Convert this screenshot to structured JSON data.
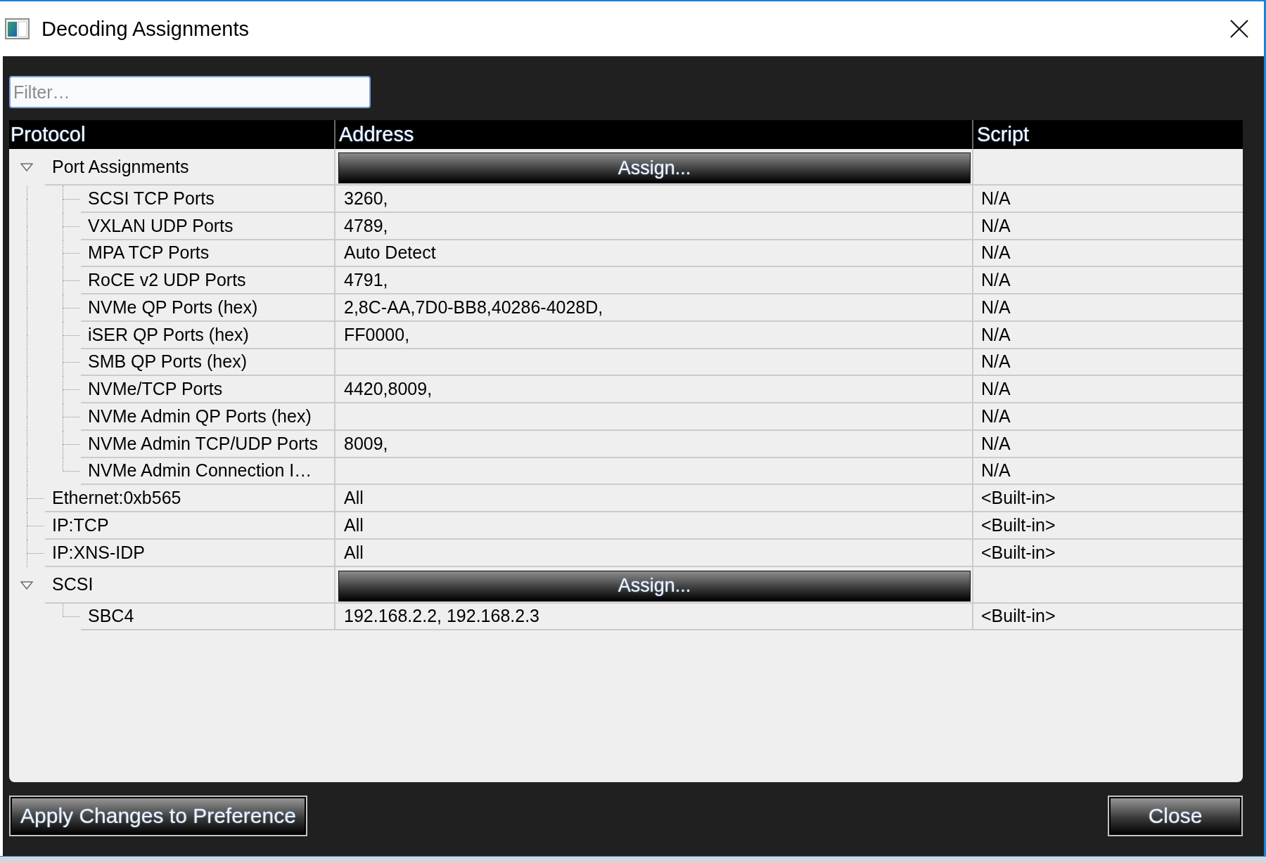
{
  "window": {
    "title": "Decoding Assignments"
  },
  "filter": {
    "placeholder": "Filter…"
  },
  "table": {
    "columns": [
      "Protocol",
      "Address",
      "Script"
    ],
    "rows": [
      {
        "kind": "group",
        "protocol": "Port Assignments",
        "expanded": true,
        "button": "Assign...",
        "children": [
          {
            "kind": "entry",
            "protocol": "SCSI TCP Ports",
            "address": "3260,",
            "script": "N/A"
          },
          {
            "kind": "entry",
            "protocol": "VXLAN UDP Ports",
            "address": "4789,",
            "script": "N/A"
          },
          {
            "kind": "entry",
            "protocol": "MPA TCP Ports",
            "address": "Auto Detect",
            "script": "N/A"
          },
          {
            "kind": "entry",
            "protocol": "RoCE v2 UDP Ports",
            "address": "4791,",
            "script": "N/A"
          },
          {
            "kind": "entry",
            "protocol": "NVMe QP Ports (hex)",
            "address": "2,8C-AA,7D0-BB8,40286-4028D,",
            "script": "N/A"
          },
          {
            "kind": "entry",
            "protocol": "iSER QP Ports (hex)",
            "address": "FF0000,",
            "script": "N/A"
          },
          {
            "kind": "entry",
            "protocol": "SMB QP Ports (hex)",
            "script": "N/A"
          },
          {
            "kind": "entry",
            "protocol": "NVMe/TCP Ports",
            "address": "4420,8009,",
            "script": "N/A"
          },
          {
            "kind": "entry",
            "protocol": "NVMe Admin QP Ports (hex)",
            "script": "N/A"
          },
          {
            "kind": "entry",
            "protocol": "NVMe Admin TCP/UDP Ports",
            "address": "8009,",
            "script": "N/A"
          },
          {
            "kind": "entry",
            "protocol": "NVMe Admin Connection I…",
            "script": "N/A"
          }
        ]
      },
      {
        "kind": "entry",
        "protocol": "Ethernet:0xb565",
        "address": "All",
        "script": "<Built-in>"
      },
      {
        "kind": "entry",
        "protocol": "IP:TCP",
        "address": "All",
        "script": "<Built-in>"
      },
      {
        "kind": "entry",
        "protocol": "IP:XNS-IDP",
        "address": "All",
        "script": "<Built-in>"
      },
      {
        "kind": "group",
        "protocol": "SCSI",
        "expanded": true,
        "button": "Assign...",
        "children": [
          {
            "kind": "entry",
            "protocol": "SBC4",
            "address": "192.168.2.2, 192.168.2.3",
            "script": "<Built-in>"
          }
        ]
      }
    ]
  },
  "buttons": [
    {
      "label": "Apply Changes to Preference"
    },
    {
      "label": "Close"
    }
  ]
}
